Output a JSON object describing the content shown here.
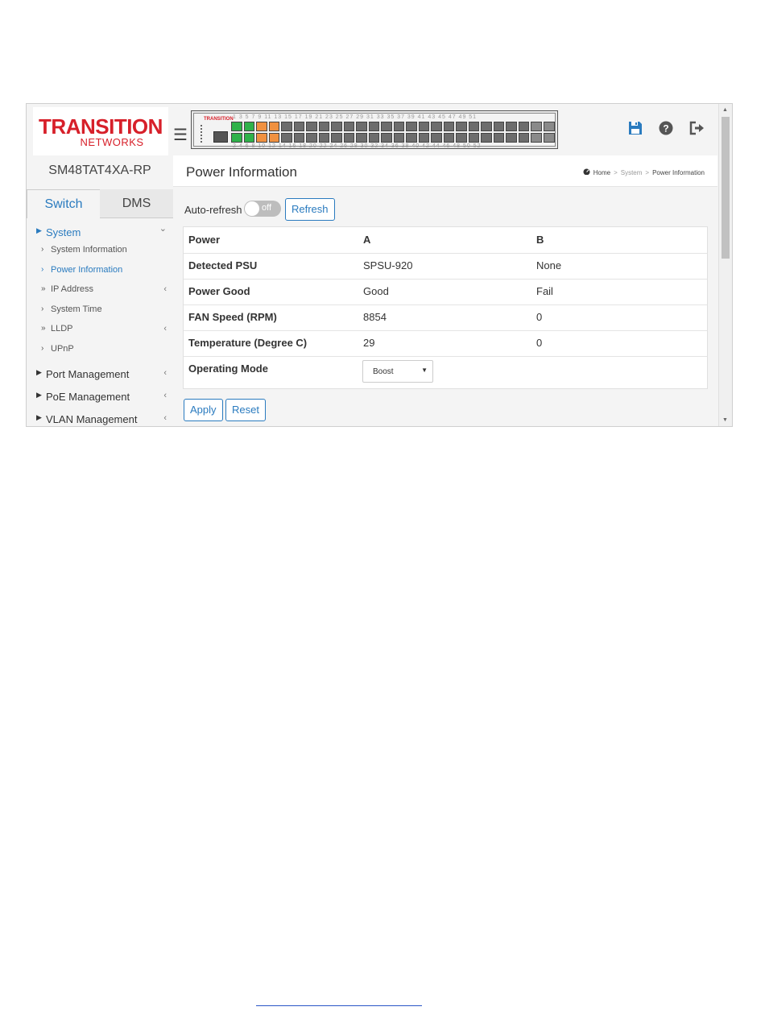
{
  "brand": {
    "logo_main": "TRANSITION",
    "logo_sub": "NETWORKS",
    "mini_logo": "TRANSITION",
    "color": "#d7202a"
  },
  "device_name": "SM48TAT4XA-RP",
  "tabs": [
    {
      "label": "Switch",
      "active": true
    },
    {
      "label": "DMS",
      "active": false
    }
  ],
  "switch_panel": {
    "top_numbers": "1 3 5 7 9 11 13 15 17 19 21 23 25 27 29 31 33 35 37 39 41 43 45 47  49 51",
    "bottom_numbers": "2 4 6 8 10 12 14 16 18 20 22 24 26 28 30 32 34 36 38 40 42 44 46 48  50 52"
  },
  "header_icons": [
    "save-icon",
    "help-icon",
    "logout-icon"
  ],
  "sidebar": {
    "menu": [
      {
        "label": "System",
        "active": true,
        "expanded": true
      },
      {
        "label": "Port Management"
      },
      {
        "label": "PoE Management"
      },
      {
        "label": "VLAN Management"
      }
    ],
    "system_items": [
      {
        "label": "System Information",
        "mark": "›"
      },
      {
        "label": "Power Information",
        "mark": "›",
        "active": true
      },
      {
        "label": "IP Address",
        "mark": "»",
        "has_children": true
      },
      {
        "label": "System Time",
        "mark": "›"
      },
      {
        "label": "LLDP",
        "mark": "»",
        "has_children": true
      },
      {
        "label": "UPnP",
        "mark": "›"
      }
    ]
  },
  "page": {
    "title": "Power Information",
    "breadcrumb": {
      "home": "Home",
      "sep": ">",
      "section": "System",
      "current": "Power Information"
    },
    "auto_refresh_label": "Auto-refresh",
    "toggle_state": "off",
    "refresh_label": "Refresh",
    "apply_label": "Apply",
    "reset_label": "Reset"
  },
  "table": {
    "header": [
      "Power",
      "A",
      "B"
    ],
    "rows": [
      [
        "Detected PSU",
        "SPSU-920",
        "None"
      ],
      [
        "Power Good",
        "Good",
        "Fail"
      ],
      [
        "FAN Speed (RPM)",
        "8854",
        "0"
      ],
      [
        "Temperature (Degree C)",
        "29",
        "0"
      ]
    ],
    "operating_mode_label": "Operating Mode",
    "operating_mode_value": "Boost"
  },
  "colors": {
    "accent": "#2a7bbf",
    "port_green": "#2fb24a",
    "port_orange": "#f09140"
  }
}
